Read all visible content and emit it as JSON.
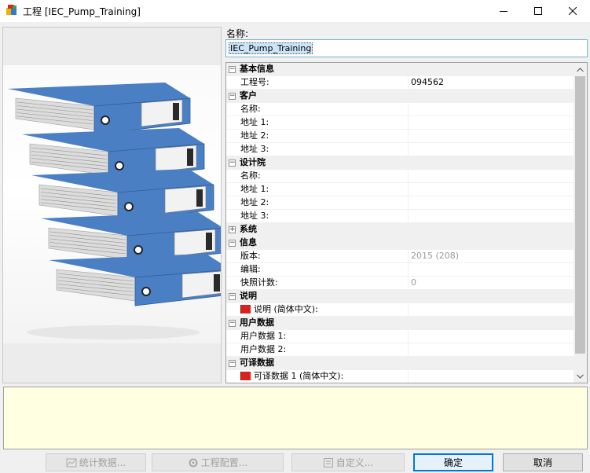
{
  "window": {
    "title": "工程 [IEC_Pump_Training]",
    "icon": "project-cube-icon"
  },
  "form": {
    "name_label": "名称:",
    "name_value": "IEC_Pump_Training"
  },
  "properties": [
    {
      "type": "category",
      "expander": "−",
      "label": "基本信息"
    },
    {
      "type": "item",
      "key": "工程号:",
      "value": "094562"
    },
    {
      "type": "category",
      "expander": "−",
      "label": "客户"
    },
    {
      "type": "item",
      "key": "名称:",
      "value": ""
    },
    {
      "type": "item",
      "key": "地址 1:",
      "value": ""
    },
    {
      "type": "item",
      "key": "地址 2:",
      "value": ""
    },
    {
      "type": "item",
      "key": "地址 3:",
      "value": ""
    },
    {
      "type": "category",
      "expander": "−",
      "label": "设计院"
    },
    {
      "type": "item",
      "key": "名称:",
      "value": ""
    },
    {
      "type": "item",
      "key": "地址 1:",
      "value": ""
    },
    {
      "type": "item",
      "key": "地址 2:",
      "value": ""
    },
    {
      "type": "item",
      "key": "地址 3:",
      "value": ""
    },
    {
      "type": "category",
      "expander": "+",
      "label": "系统"
    },
    {
      "type": "category",
      "expander": "−",
      "label": "信息"
    },
    {
      "type": "item",
      "key": "版本:",
      "value": "2015 (208)",
      "readonly": true
    },
    {
      "type": "item",
      "key": "编辑:",
      "value": ""
    },
    {
      "type": "item",
      "key": "快照计数:",
      "value": "0",
      "readonly": true
    },
    {
      "type": "category",
      "expander": "−",
      "label": "说明"
    },
    {
      "type": "item",
      "key": "说明 (简体中文):",
      "value": "",
      "flag": true
    },
    {
      "type": "category",
      "expander": "−",
      "label": "用户数据"
    },
    {
      "type": "item",
      "key": "用户数据 1:",
      "value": ""
    },
    {
      "type": "item",
      "key": "用户数据 2:",
      "value": ""
    },
    {
      "type": "category",
      "expander": "−",
      "label": "可译数据"
    },
    {
      "type": "item",
      "key": "可译数据 1 (简体中文):",
      "value": "",
      "flag": true
    }
  ],
  "buttons": {
    "statistics": "统计数据...",
    "project_config": "工程配置...",
    "customize": "自定义...",
    "ok": "确定",
    "cancel": "取消"
  },
  "colors": {
    "binder_blue": "#4a7fc4",
    "description_bg": "#ffffe1",
    "focus_border": "#0078d7"
  }
}
